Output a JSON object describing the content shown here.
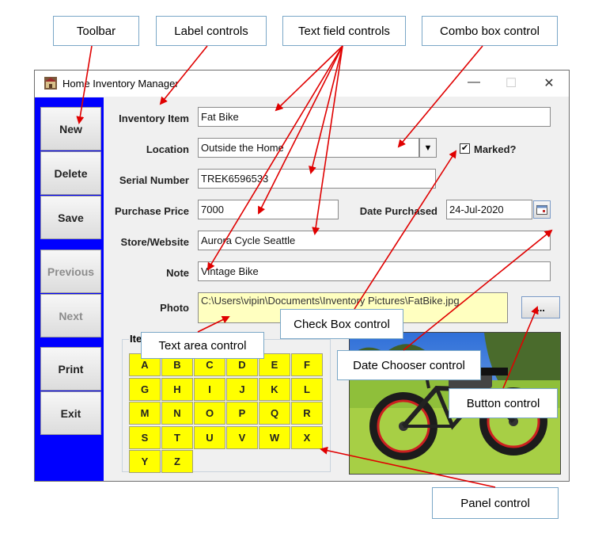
{
  "callouts": {
    "toolbar": "Toolbar",
    "label_controls": "Label controls",
    "text_field_controls": "Text field controls",
    "combo_box_control": "Combo box control",
    "check_box_control": "Check Box control",
    "text_area_control": "Text area control",
    "date_chooser_control": "Date Chooser control",
    "button_control": "Button control",
    "panel_control": "Panel control"
  },
  "window": {
    "title": "Home Inventory Manager",
    "minimize": "—",
    "maximize": "☐",
    "close": "✕"
  },
  "toolbar": {
    "new": "New",
    "delete": "Delete",
    "save": "Save",
    "previous": "Previous",
    "next": "Next",
    "print": "Print",
    "exit": "Exit"
  },
  "form": {
    "inventory_item_label": "Inventory Item",
    "inventory_item_value": "Fat Bike",
    "location_label": "Location",
    "location_value": "Outside the Home",
    "marked_label": "Marked?",
    "marked_checked": "✔",
    "serial_label": "Serial Number",
    "serial_value": "TREK6596533",
    "price_label": "Purchase Price",
    "price_value": "7000",
    "date_label": "Date Purchased",
    "date_value": "24-Jul-2020",
    "store_label": "Store/Website",
    "store_value": "Aurora Cycle Seattle",
    "note_label": "Note",
    "note_value": "Vintage Bike",
    "photo_label": "Photo",
    "photo_path": "C:\\Users\\vipin\\Documents\\Inventory Pictures\\FatBike.jpg",
    "photo_button": "..."
  },
  "search_panel": {
    "title": "Ite",
    "keys": [
      "A",
      "B",
      "C",
      "D",
      "E",
      "F",
      "G",
      "H",
      "I",
      "J",
      "K",
      "L",
      "M",
      "N",
      "O",
      "P",
      "Q",
      "R",
      "S",
      "T",
      "U",
      "V",
      "W",
      "X",
      "Y",
      "Z"
    ]
  },
  "colors": {
    "toolbar_bg": "#0000ff",
    "key_bg": "#ffff00",
    "textarea_bg": "#ffffc0",
    "arrow": "#e00000"
  }
}
